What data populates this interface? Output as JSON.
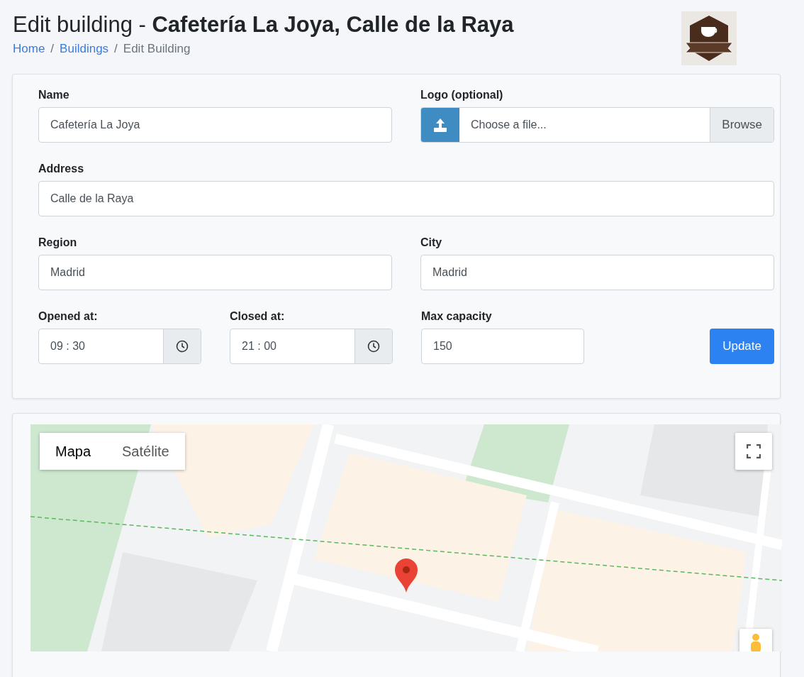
{
  "header": {
    "title": "Edit building - **Cafetería La Joya, Calle de la Raya**",
    "separator": "/",
    "breadcrumb": [
      {
        "label": "Home",
        "link": true
      },
      {
        "label": "Buildings",
        "link": true
      },
      {
        "label": "Edit Building",
        "link": false
      }
    ]
  },
  "form": {
    "name": {
      "label": "Name",
      "value": "Cafetería La Joya"
    },
    "logo": {
      "label": "Logo (optional)",
      "placeholder": "Choose a file...",
      "button": "Browse"
    },
    "address": {
      "label": "Address",
      "value": "Calle de la Raya"
    },
    "region": {
      "label": "Region",
      "value": "Madrid"
    },
    "city": {
      "label": "City",
      "value": "Madrid"
    },
    "opened": {
      "label": "Opened at:",
      "value": "09 : 30"
    },
    "closed": {
      "label": "Closed at:",
      "value": "21 : 00"
    },
    "capacity": {
      "label": "Max capacity",
      "value": "150"
    },
    "submit": "Update"
  },
  "map": {
    "kind": "picture",
    "map_types": [
      {
        "label": "Mapa",
        "selected": true
      },
      {
        "label": "Satélite",
        "selected": false
      }
    ]
  }
}
